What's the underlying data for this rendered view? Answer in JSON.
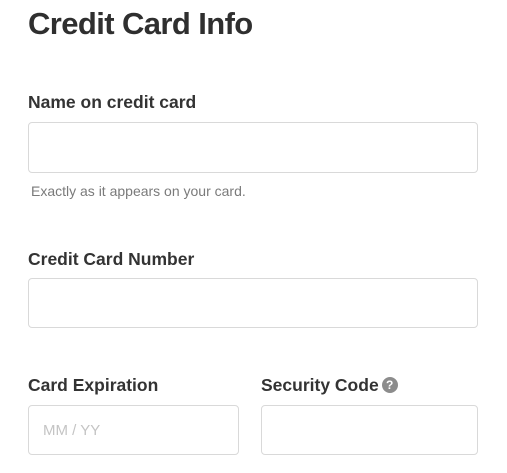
{
  "title": "Credit Card Info",
  "name_field": {
    "label": "Name on credit card",
    "value": "",
    "help": "Exactly as it appears on your card."
  },
  "number_field": {
    "label": "Credit Card Number",
    "value": ""
  },
  "expiration_field": {
    "label": "Card Expiration",
    "placeholder": "MM / YY",
    "value": ""
  },
  "security_field": {
    "label": "Security Code",
    "help_icon": "question-mark-icon",
    "help_glyph": "?",
    "value": ""
  },
  "colors": {
    "label": "#333333",
    "help_text": "#7a7a7a",
    "input_border": "#d9d9d9",
    "placeholder": "#c4c4c4",
    "help_icon_bg": "#8c8c8c"
  }
}
